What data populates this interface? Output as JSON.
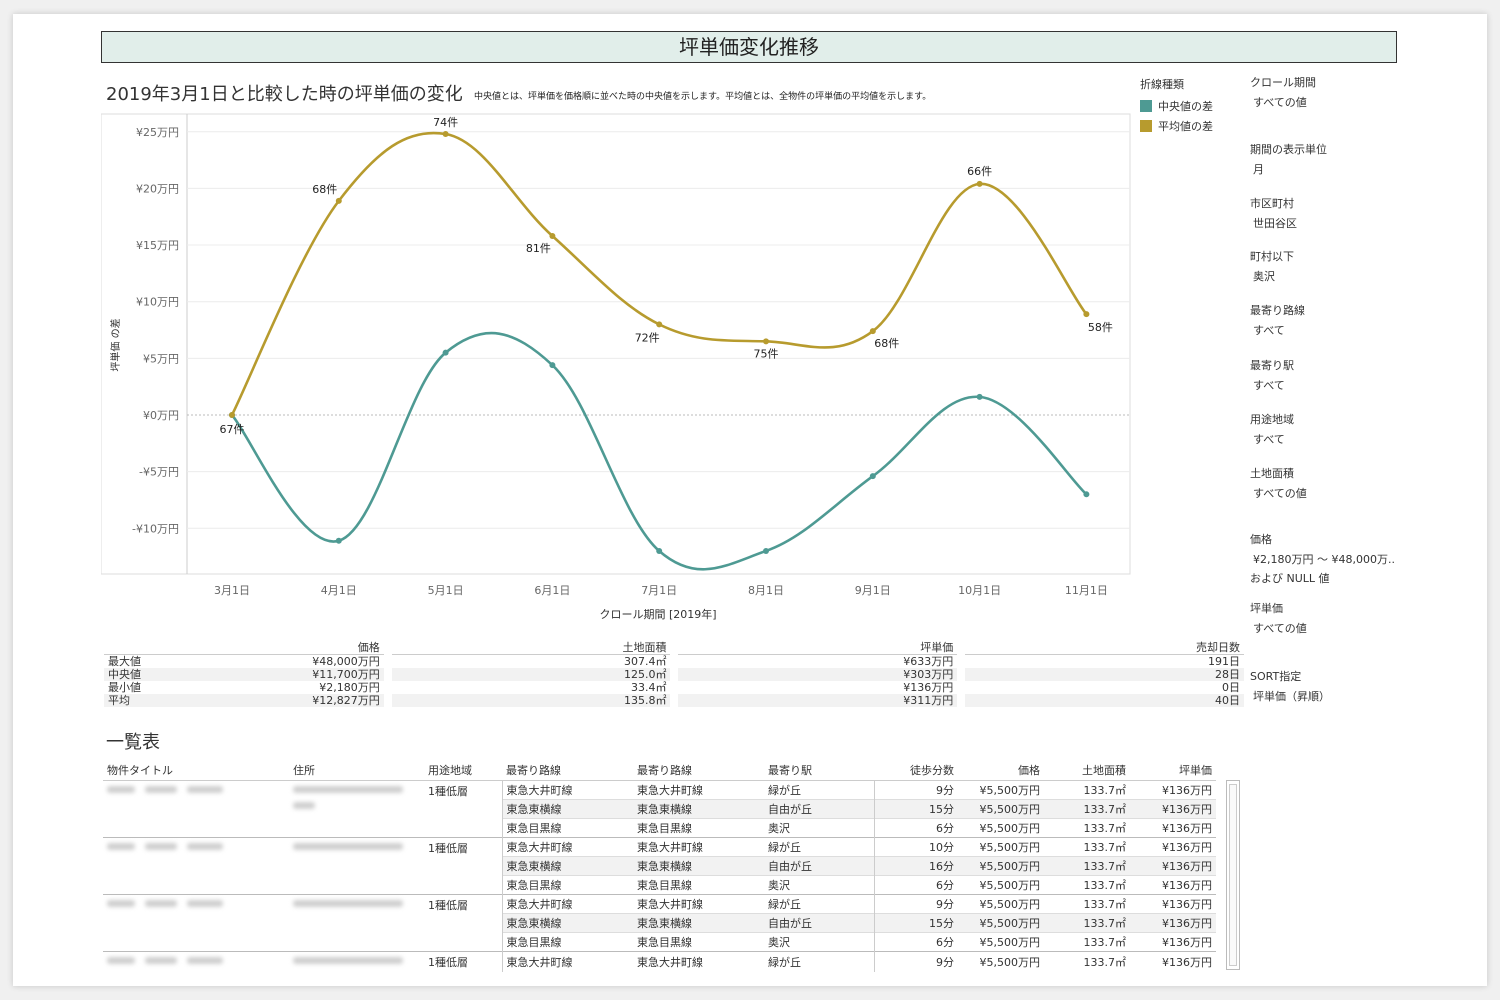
{
  "page_title": "坪単価変化推移",
  "chart_title": "2019年3月1日と比較した時の坪単価の変化",
  "chart_note": "中央値とは、坪単価を価格順に並べた時の中央値を示します。平均値とは、全物件の坪単価の平均値を示します。",
  "legend": {
    "title": "折線種類",
    "items": [
      {
        "label": "中央値の差",
        "color": "#4e9a93"
      },
      {
        "label": "平均値の差",
        "color": "#b79b2e"
      }
    ]
  },
  "chart_data": {
    "type": "line",
    "x": [
      "3月1日",
      "4月1日",
      "5月1日",
      "6月1日",
      "7月1日",
      "8月1日",
      "9月1日",
      "10月1日",
      "11月1日"
    ],
    "xlabel": "クロール期間 [2019年]",
    "ylabel": "坪単価 の差",
    "ylim": [
      -14,
      26
    ],
    "yticks": [
      -10,
      -5,
      0,
      5,
      10,
      15,
      20,
      25
    ],
    "ytick_labels": [
      "-¥10万円",
      "-¥5万円",
      "¥0万円",
      "¥5万円",
      "¥10万円",
      "¥15万円",
      "¥20万円",
      "¥25万円"
    ],
    "series": [
      {
        "name": "中央値の差",
        "color": "#4e9a93",
        "values": [
          0,
          -11.1,
          5.5,
          4.4,
          -12.0,
          -12.0,
          -5.4,
          1.6,
          -7.0
        ]
      },
      {
        "name": "平均値の差",
        "color": "#b79b2e",
        "values": [
          0,
          18.9,
          24.8,
          15.8,
          8.0,
          6.5,
          7.4,
          20.4,
          8.9
        ],
        "labels": [
          "67件",
          "68件",
          "74件",
          "81件",
          "72件",
          "75件",
          "68件",
          "66件",
          "58件"
        ]
      }
    ]
  },
  "filters": [
    {
      "label": "クロール期間",
      "value": "すべての値"
    },
    {
      "label": "期間の表示単位",
      "value": "月"
    },
    {
      "label": "市区町村",
      "value": "世田谷区"
    },
    {
      "label": "町村以下",
      "value": "奥沢"
    },
    {
      "label": "最寄り路線",
      "value": "すべて"
    },
    {
      "label": "最寄り駅",
      "value": "すべて"
    },
    {
      "label": "用途地域",
      "value": "すべて"
    },
    {
      "label": "土地面積",
      "value": "すべての値"
    },
    {
      "label": "価格",
      "value": "¥2,180万円 ～ ¥48,000万..",
      "value2": "および NULL 値"
    },
    {
      "label": "坪単価",
      "value": "すべての値"
    },
    {
      "label": "SORT指定",
      "value": "坪単価（昇順）"
    }
  ],
  "stats": {
    "columns": [
      "価格",
      "土地面積",
      "坪単価",
      "売却日数"
    ],
    "rows": [
      {
        "label": "最大値",
        "values": [
          "¥48,000万円",
          "307.4㎡",
          "¥633万円",
          "191日"
        ]
      },
      {
        "label": "中央値",
        "values": [
          "¥11,700万円",
          "125.0㎡",
          "¥303万円",
          "28日"
        ]
      },
      {
        "label": "最小値",
        "values": [
          "¥2,180万円",
          "33.4㎡",
          "¥136万円",
          "0日"
        ]
      },
      {
        "label": "平均",
        "values": [
          "¥12,827万円",
          "135.8㎡",
          "¥311万円",
          "40日"
        ]
      }
    ]
  },
  "list": {
    "title": "一覧表",
    "headers": [
      "物件タイトル",
      "住所",
      "用途地域",
      "最寄り路線",
      "最寄り路線",
      "最寄り駅",
      "徒歩分数",
      "価格",
      "土地面積",
      "坪単価"
    ],
    "groups": [
      {
        "zone": "1種低層",
        "rows": [
          [
            "東急大井町線",
            "東急大井町線",
            "緑が丘",
            "9分",
            "¥5,500万円",
            "133.7㎡",
            "¥136万円"
          ],
          [
            "東急東横線",
            "東急東横線",
            "自由が丘",
            "15分",
            "¥5,500万円",
            "133.7㎡",
            "¥136万円"
          ],
          [
            "東急目黒線",
            "東急目黒線",
            "奥沢",
            "6分",
            "¥5,500万円",
            "133.7㎡",
            "¥136万円"
          ]
        ]
      },
      {
        "zone": "1種低層",
        "rows": [
          [
            "東急大井町線",
            "東急大井町線",
            "緑が丘",
            "10分",
            "¥5,500万円",
            "133.7㎡",
            "¥136万円"
          ],
          [
            "東急東横線",
            "東急東横線",
            "自由が丘",
            "16分",
            "¥5,500万円",
            "133.7㎡",
            "¥136万円"
          ],
          [
            "東急目黒線",
            "東急目黒線",
            "奥沢",
            "6分",
            "¥5,500万円",
            "133.7㎡",
            "¥136万円"
          ]
        ]
      },
      {
        "zone": "1種低層",
        "rows": [
          [
            "東急大井町線",
            "東急大井町線",
            "緑が丘",
            "9分",
            "¥5,500万円",
            "133.7㎡",
            "¥136万円"
          ],
          [
            "東急東横線",
            "東急東横線",
            "自由が丘",
            "15分",
            "¥5,500万円",
            "133.7㎡",
            "¥136万円"
          ],
          [
            "東急目黒線",
            "東急目黒線",
            "奥沢",
            "6分",
            "¥5,500万円",
            "133.7㎡",
            "¥136万円"
          ]
        ]
      },
      {
        "zone": "1種低層",
        "rows": [
          [
            "東急大井町線",
            "東急大井町線",
            "緑が丘",
            "9分",
            "¥5,500万円",
            "133.7㎡",
            "¥136万円"
          ]
        ]
      }
    ]
  }
}
